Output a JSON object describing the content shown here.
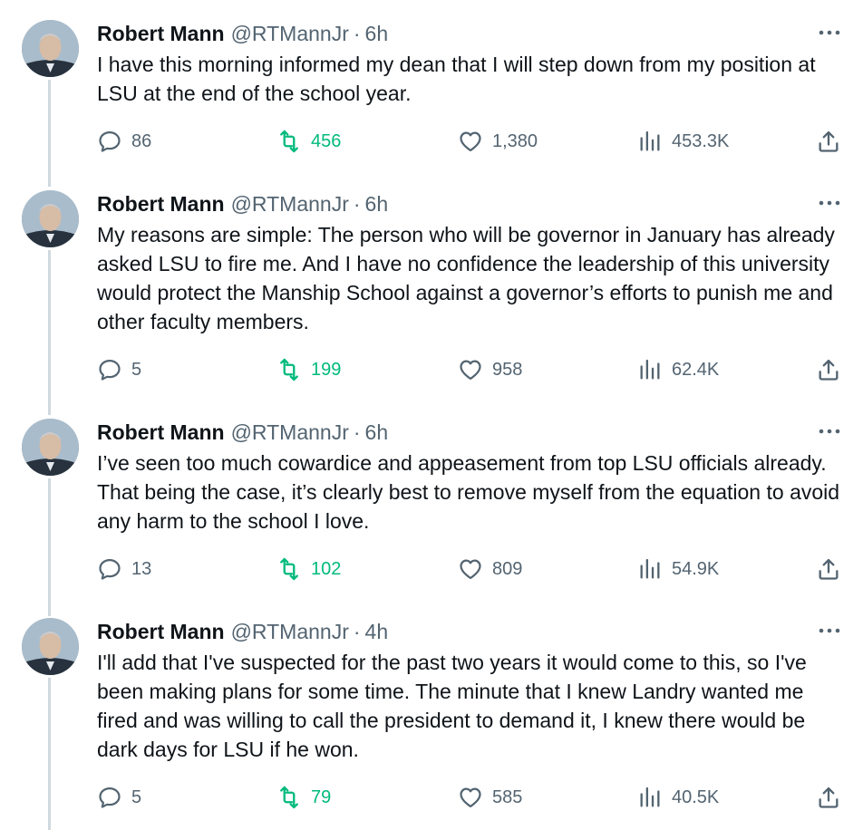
{
  "thread": {
    "tweets": [
      {
        "author_name": "Robert Mann",
        "handle": "@RTMannJr",
        "separator": "·",
        "time": "6h",
        "text": "I have this morning informed my dean that I will step down from my position at LSU at the end of the school year.",
        "replies": "86",
        "retweets": "456",
        "likes": "1,380",
        "views": "453.3K"
      },
      {
        "author_name": "Robert Mann",
        "handle": "@RTMannJr",
        "separator": "·",
        "time": "6h",
        "text": "My reasons are simple: The person who will be governor in January has already asked LSU to fire me. And I have no confidence the leadership of this university would protect the Manship School against a governor’s efforts to punish me and other faculty members.",
        "replies": "5",
        "retweets": "199",
        "likes": "958",
        "views": "62.4K"
      },
      {
        "author_name": "Robert Mann",
        "handle": "@RTMannJr",
        "separator": "·",
        "time": "6h",
        "text": "I’ve seen too much cowardice and appeasement from top LSU officials already. That being the case, it’s clearly best to remove myself from the equation to avoid any harm to the school I love.",
        "replies": "13",
        "retweets": "102",
        "likes": "809",
        "views": "54.9K"
      },
      {
        "author_name": "Robert Mann",
        "handle": "@RTMannJr",
        "separator": "·",
        "time": "4h",
        "text": "I'll add that I've suspected for the past two years it would come to this, so I've been making plans for some time. The minute that I knew Landry wanted me fired and was willing to call the president to demand it, I knew there would be dark days for LSU if he won.",
        "replies": "5",
        "retweets": "79",
        "likes": "585",
        "views": "40.5K"
      }
    ]
  },
  "colors": {
    "text": "#0f1419",
    "secondary": "#536471",
    "retweet_green": "#00ba7c",
    "thread_line": "#cfd9de"
  },
  "icons": {
    "reply": "reply-bubble-icon",
    "retweet": "retweet-arrows-icon",
    "like": "heart-icon",
    "views": "bar-chart-icon",
    "share": "share-upload-icon",
    "more": "more-dots-icon"
  }
}
